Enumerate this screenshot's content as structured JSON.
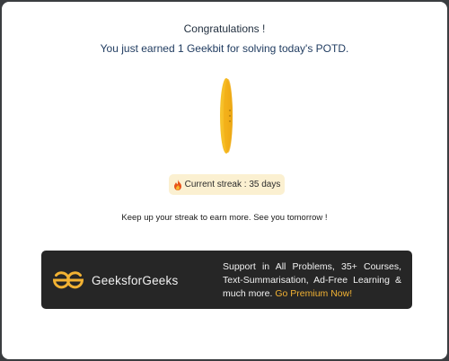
{
  "modal": {
    "title": "Congratulations !",
    "subtitle": "You just earned 1 Geekbit for solving today's POTD.",
    "coin_icon": "geekbit-coin-icon",
    "streak": {
      "icon": "fire-icon",
      "label": "Current streak : 35 days"
    },
    "keep_up_text": "Keep up your streak to earn more. See you tomorrow !"
  },
  "banner": {
    "brand_name": "GeeksforGeeks",
    "logo_icon": "geeksforgeeks-logo-icon",
    "promo_text": "Support in All Problems, 35+ Courses, Text-Summarisation, Ad-Free Learning & much more.",
    "cta_label": "Go Premium Now!"
  },
  "colors": {
    "backdrop": "#3a3d40",
    "modal_bg": "#ffffff",
    "coin_gold": "#f5b820",
    "streak_pill_bg": "#fbf0d1",
    "banner_bg": "#262626",
    "cta": "#f2b233",
    "brand_green": "#2f8d46"
  }
}
